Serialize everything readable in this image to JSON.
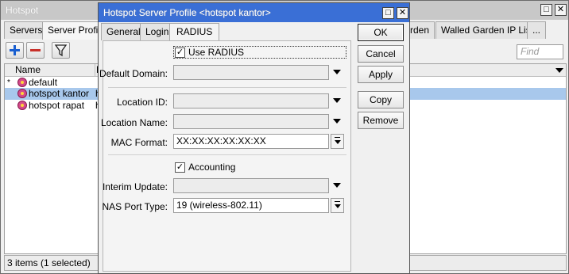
{
  "hotspot_window": {
    "title": "Hotspot",
    "tabs": [
      "Servers",
      "Server Profile",
      "rden",
      "Walled Garden IP List",
      "..."
    ],
    "find_placeholder": "Find",
    "columns": {
      "name": "Name",
      "col2": "D"
    },
    "rows": [
      {
        "mark": "*",
        "name": "default",
        "col2": "",
        "selected": false
      },
      {
        "mark": "",
        "name": "hotspot kantor",
        "col2": "h",
        "selected": true
      },
      {
        "mark": "",
        "name": "hotspot rapat",
        "col2": "h",
        "selected": false
      }
    ],
    "status": "3 items (1 selected)"
  },
  "dialog": {
    "title": "Hotspot Server Profile <hotspot kantor>",
    "tabs": [
      "General",
      "Login",
      "RADIUS"
    ],
    "active_tab": "RADIUS",
    "use_radius": {
      "label": "Use RADIUS",
      "checked": true
    },
    "default_domain": {
      "label": "Default Domain:",
      "value": ""
    },
    "location_id": {
      "label": "Location ID:",
      "value": ""
    },
    "location_name": {
      "label": "Location Name:",
      "value": ""
    },
    "mac_format": {
      "label": "MAC Format:",
      "value": "XX:XX:XX:XX:XX:XX"
    },
    "accounting": {
      "label": "Accounting",
      "checked": true
    },
    "interim_update": {
      "label": "Interim Update:",
      "value": ""
    },
    "nas_port_type": {
      "label": "NAS Port Type:",
      "value": "19 (wireless-802.11)"
    },
    "buttons": {
      "ok": "OK",
      "cancel": "Cancel",
      "apply": "Apply",
      "copy": "Copy",
      "remove": "Remove"
    }
  },
  "colors": {
    "dialog_titlebar": "#3a6fd6",
    "inactive_titlebar": "#c8c8c8",
    "selected_row": "#a8c8ec",
    "add_icon": "#1a5fd0",
    "remove_icon": "#c8302a"
  }
}
